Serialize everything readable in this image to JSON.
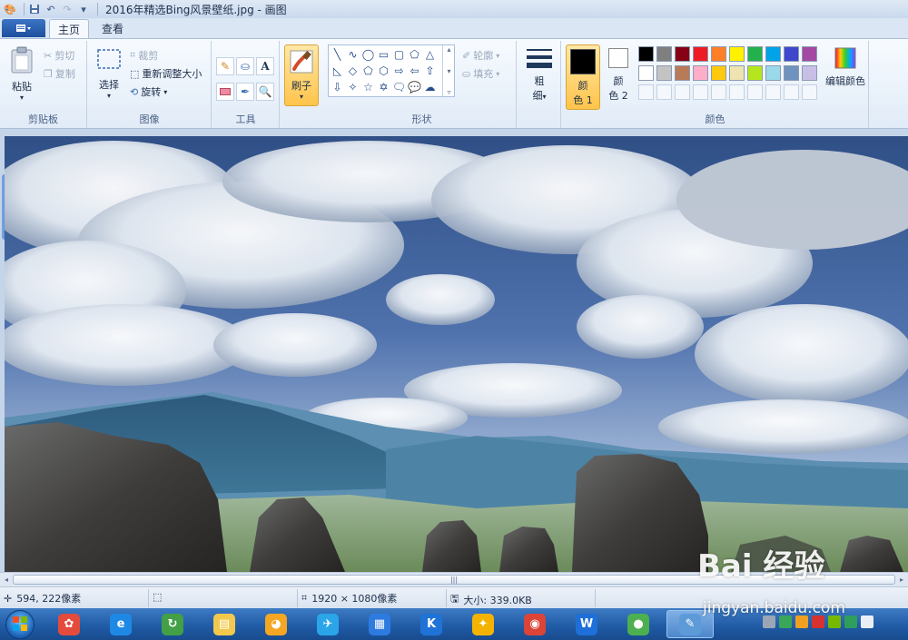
{
  "window": {
    "title": "2016年精选Bing风景壁纸.jpg - 画图"
  },
  "tabs": [
    {
      "label": "主页",
      "active": true
    },
    {
      "label": "查看",
      "active": false
    }
  ],
  "ribbon": {
    "clipboard": {
      "label": "剪贴板",
      "paste": "粘贴",
      "cut": "剪切",
      "copy": "复制"
    },
    "image": {
      "label": "图像",
      "select": "选择",
      "crop": "裁剪",
      "resize": "重新调整大小",
      "rotate": "旋转"
    },
    "tools": {
      "label": "工具",
      "text_tool_glyph": "A"
    },
    "brush": {
      "label": "刷子"
    },
    "shapes": {
      "label": "形状",
      "outline": "轮廓",
      "fill": "填充"
    },
    "size": {
      "label_line1": "粗",
      "label_line2": "细"
    },
    "colors": {
      "label": "颜色",
      "color1_line1": "颜",
      "color1_line2": "色 1",
      "color2_line1": "颜",
      "color2_line2": "色 2",
      "edit_colors": "编辑颜色",
      "color1_value": "#000000",
      "color2_value": "#ffffff",
      "palette_row1": [
        "#000000",
        "#7f7f7f",
        "#880015",
        "#ed1c24",
        "#ff7f27",
        "#fff200",
        "#22b14c",
        "#00a2e8",
        "#3f48cc",
        "#a349a4"
      ],
      "palette_row2": [
        "#ffffff",
        "#c3c3c3",
        "#b97a57",
        "#ffaec9",
        "#ffc90e",
        "#efe4b0",
        "#b5e61d",
        "#99d9ea",
        "#7092be",
        "#c8bfe7"
      ]
    }
  },
  "status": {
    "cursor_pos": "594, 222像素",
    "dimensions": "1920 × 1080像素",
    "file_size": "大小: 339.0KB"
  },
  "taskbar": {
    "apps": [
      {
        "name": "pinwheel-app-icon",
        "color": "#e44b3c"
      },
      {
        "name": "ie-browser-icon",
        "color": "#1e88e5"
      },
      {
        "name": "green-refresh-app-icon",
        "color": "#43a047"
      },
      {
        "name": "file-explorer-icon",
        "color": "#f2c94c"
      },
      {
        "name": "paint-palette-icon",
        "color": "#f5a623"
      },
      {
        "name": "bird-app-icon",
        "color": "#2aa5e8"
      },
      {
        "name": "blue-square-app-icon",
        "color": "#2e7be0"
      },
      {
        "name": "k-app-icon",
        "color": "#1f73d6"
      },
      {
        "name": "puzzle-app-icon",
        "color": "#f5b301"
      },
      {
        "name": "chrome-browser-icon",
        "color": "#db4437"
      },
      {
        "name": "w-app-icon",
        "color": "#1e6fd9"
      },
      {
        "name": "melon-app-icon",
        "color": "#4caf50"
      },
      {
        "name": "paint-app-icon",
        "color": "#5c9ad8"
      }
    ],
    "active_app": "paint-app-icon"
  },
  "watermark": {
    "brand": "Bai 经验",
    "url": "jingyan.baidu.com"
  }
}
